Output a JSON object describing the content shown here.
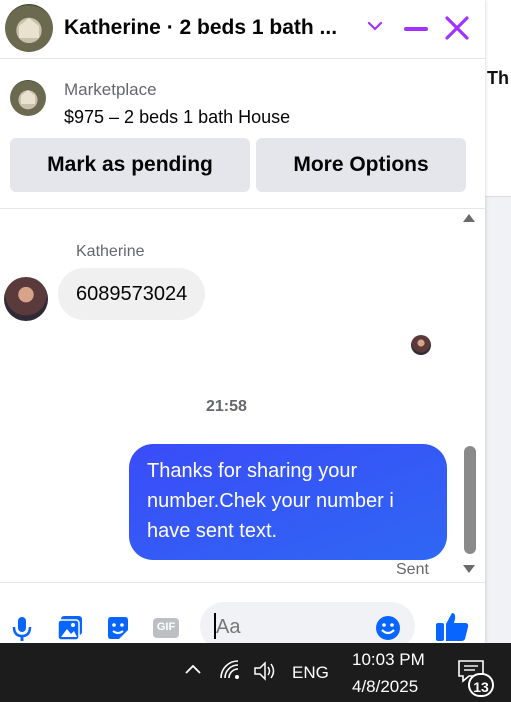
{
  "header": {
    "title": "Katherine · 2 beds 1 bath ..."
  },
  "background": {
    "fragment": "Th"
  },
  "marketplace": {
    "label": "Marketplace",
    "listing": "$975 – 2 beds 1 bath House",
    "mark_pending_label": "Mark as pending",
    "more_options_label": "More Options"
  },
  "conversation": {
    "sender_name": "Katherine",
    "incoming_message": "6089573024",
    "timestamp": "21:58",
    "outgoing_message": "Thanks for sharing your number.Chek your number i have sent text.",
    "status": "Sent"
  },
  "composer": {
    "placeholder": "Aa",
    "gif_label": "GIF"
  },
  "taskbar": {
    "language": "ENG",
    "time": "10:03 PM",
    "date": "4/8/2025",
    "notification_count": "13"
  },
  "colors": {
    "accent": "#a033ff",
    "messenger_blue": "#0866ff",
    "outgoing_bubble": "#3a4cf9"
  }
}
